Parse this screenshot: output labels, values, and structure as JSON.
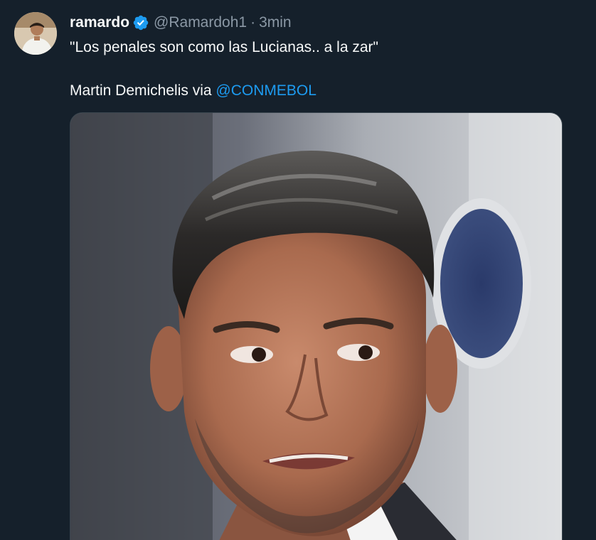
{
  "tweet": {
    "display_name": "ramardo",
    "handle": "@Ramardoh1",
    "separator": "·",
    "time": "3min",
    "text_line1": "\"Los penales son como las Lucianas.. a la zar\"",
    "text_line2_prefix": "Martin Demichelis via ",
    "mention": "@CONMEBOL"
  },
  "icons": {
    "verified": "verified-badge-icon"
  },
  "colors": {
    "background": "#15202b",
    "text": "#f7f9f9",
    "secondary_text": "#8b98a5",
    "link": "#1d9bf0",
    "verified": "#1d9bf0"
  }
}
